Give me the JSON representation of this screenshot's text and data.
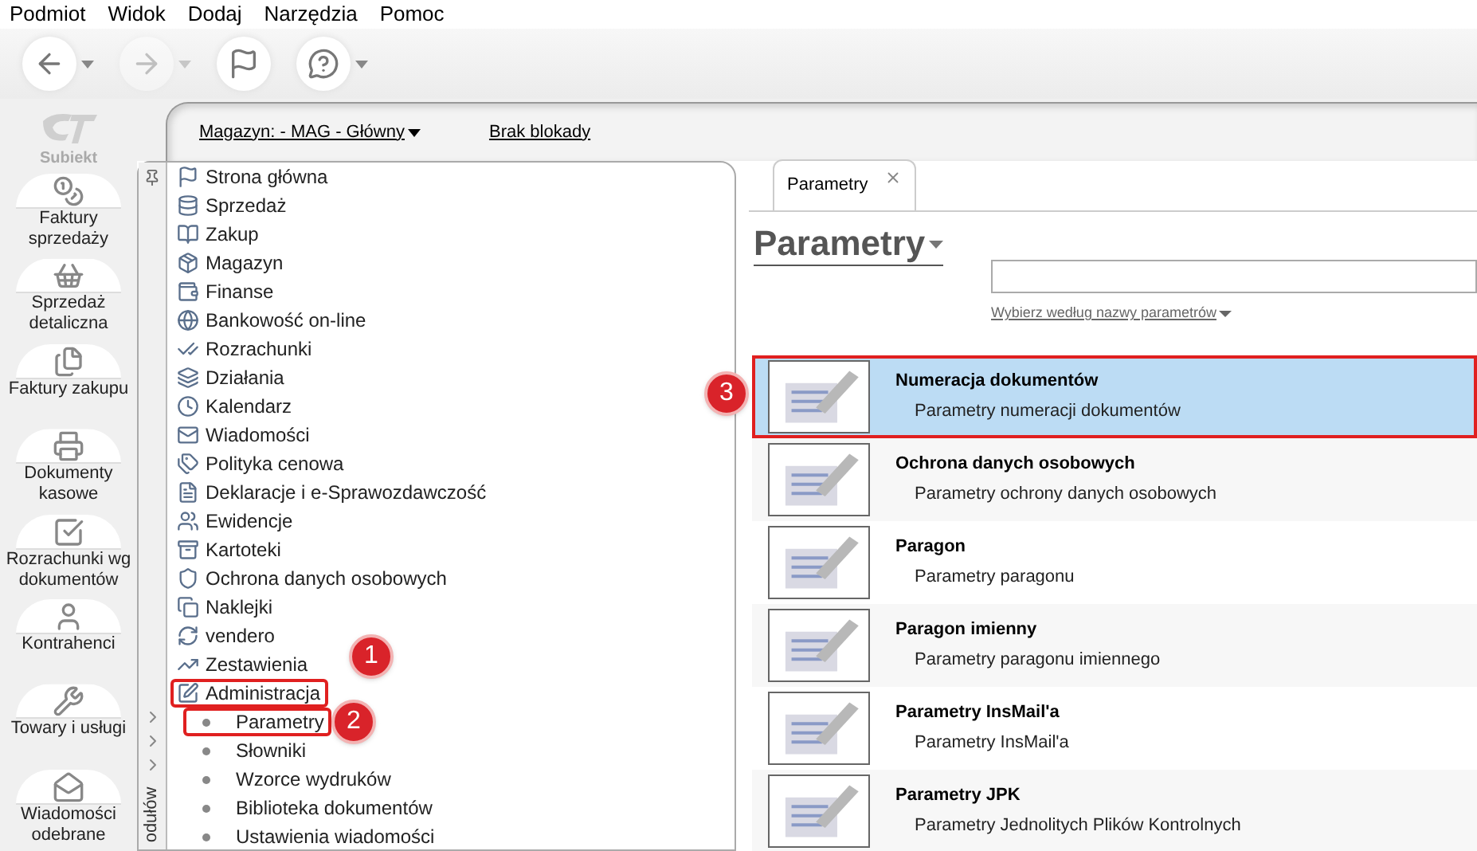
{
  "menu": [
    "Podmiot",
    "Widok",
    "Dodaj",
    "Narzędzia",
    "Pomoc"
  ],
  "toolbar": [
    {
      "has_menu": true,
      "disabled": false
    },
    {
      "has_menu": true,
      "disabled": true
    },
    {
      "has_menu": false,
      "disabled": false
    },
    {
      "has_menu": true,
      "disabled": false
    }
  ],
  "logo": {
    "label": "Subiekt"
  },
  "sidebar": {
    "items": [
      "Faktury sprzedaży",
      "Sprzedaż detaliczna",
      "Faktury zakupu",
      "Dokumenty kasowe",
      "Rozrachunki wg dokumentów",
      "Kontrahenci",
      "Towary i usługi",
      "Wiadomości odebrane"
    ]
  },
  "header": {
    "warehouse": "Magazyn: - MAG - Główny",
    "lock": "Brak blokady"
  },
  "nav_strip": {
    "label": "odułów"
  },
  "tree": [
    {
      "label": "Strona główna",
      "outlined": false
    },
    {
      "label": "Sprzedaż",
      "outlined": false
    },
    {
      "label": "Zakup",
      "outlined": false
    },
    {
      "label": "Magazyn",
      "outlined": false
    },
    {
      "label": "Finanse",
      "outlined": false
    },
    {
      "label": "Bankowość on-line",
      "outlined": false
    },
    {
      "label": "Rozrachunki",
      "outlined": false
    },
    {
      "label": "Działania",
      "outlined": false
    },
    {
      "label": "Kalendarz",
      "outlined": false
    },
    {
      "label": "Wiadomości",
      "outlined": false
    },
    {
      "label": "Polityka cenowa",
      "outlined": false
    },
    {
      "label": "Deklaracje i e-Sprawozdawczość",
      "outlined": false
    },
    {
      "label": "Ewidencje",
      "outlined": false
    },
    {
      "label": "Kartoteki",
      "outlined": false
    },
    {
      "label": "Ochrona danych osobowych",
      "outlined": false
    },
    {
      "label": "Naklejki",
      "outlined": false
    },
    {
      "label": "vendero",
      "outlined": false
    },
    {
      "label": "Zestawienia",
      "outlined": false
    },
    {
      "label": "Administracja",
      "outlined": true,
      "callout": "1",
      "children": [
        {
          "label": "Parametry",
          "outlined": true,
          "callout": "2"
        },
        {
          "label": "Słowniki",
          "outlined": false
        },
        {
          "label": "Wzorce wydruków",
          "outlined": false
        },
        {
          "label": "Biblioteka dokumentów",
          "outlined": false
        },
        {
          "label": "Ustawienia wiadomości",
          "outlined": false
        }
      ]
    }
  ],
  "tabs": [
    {
      "label": "Parametry",
      "selected": true
    }
  ],
  "page": {
    "title": "Parametry",
    "filter": "Wybierz według nazwy parametrów"
  },
  "rows": [
    {
      "title": "Numeracja dokumentów",
      "subtitle": "Parametry numeracji dokumentów",
      "selected": true,
      "outlined": true,
      "callout": "3"
    },
    {
      "title": "Ochrona danych osobowych",
      "subtitle": "Parametry ochrony danych osobowych",
      "selected": false,
      "outlined": false
    },
    {
      "title": "Paragon",
      "subtitle": "Parametry paragonu",
      "selected": false,
      "outlined": false
    },
    {
      "title": "Paragon imienny",
      "subtitle": "Parametry paragonu imiennego",
      "selected": false,
      "outlined": false
    },
    {
      "title": "Parametry InsMail'a",
      "subtitle": "Parametry InsMail'a",
      "selected": false,
      "outlined": false
    },
    {
      "title": "Parametry JPK",
      "subtitle": "Parametry Jednolitych Plików Kontrolnych",
      "selected": false,
      "outlined": false
    }
  ]
}
